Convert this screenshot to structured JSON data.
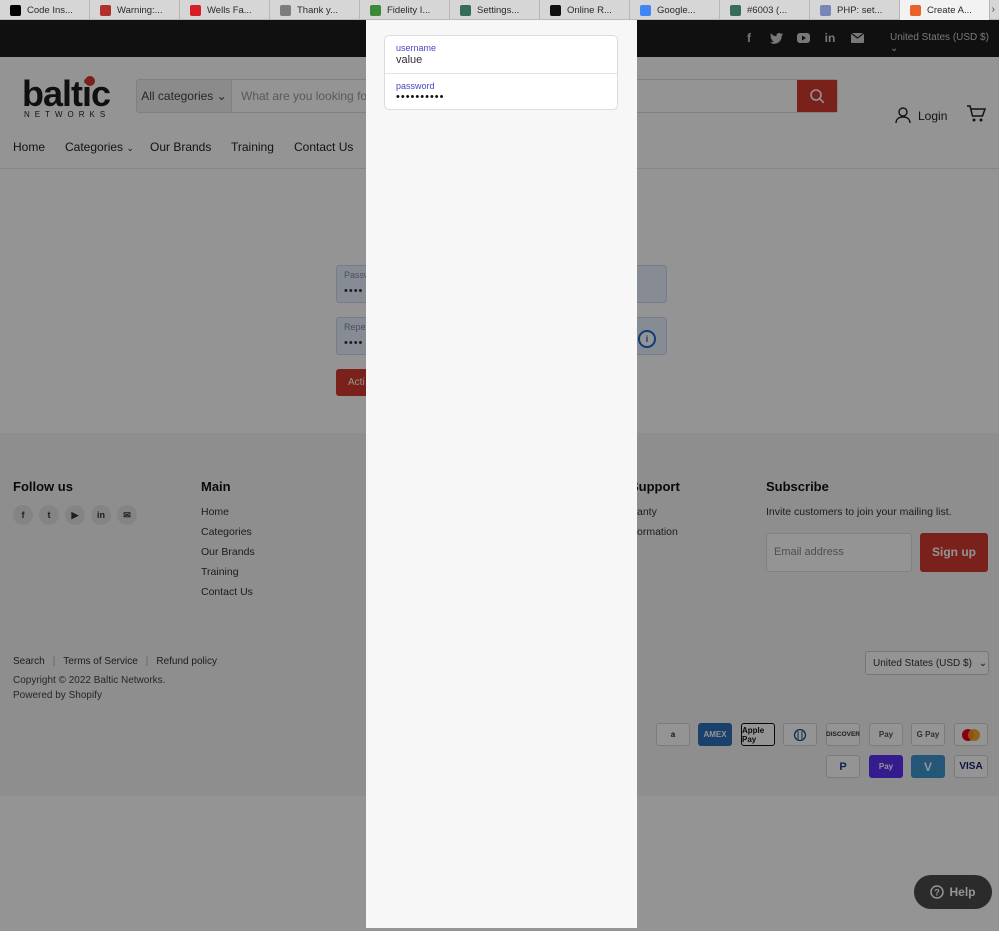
{
  "browser_tabs": [
    {
      "label": "Code Ins...",
      "icon": "jetbrains-icon",
      "color": "#000000"
    },
    {
      "label": "Warning:...",
      "icon": "alert-icon",
      "color": "#b0312c"
    },
    {
      "label": "Wells Fa...",
      "icon": "wells-fargo-icon",
      "color": "#d71e28"
    },
    {
      "label": "Thank y...",
      "icon": "u-icon",
      "color": "#7d7d7d"
    },
    {
      "label": "Fidelity I...",
      "icon": "fidelity-icon",
      "color": "#3a8a3a"
    },
    {
      "label": "Settings...",
      "icon": "rh-icon",
      "color": "#356c5a"
    },
    {
      "label": "Online R...",
      "icon": "amazon-icon",
      "color": "#111111"
    },
    {
      "label": "Google...",
      "icon": "google-ads-icon",
      "color": "#4285f4"
    },
    {
      "label": "#6003 (...",
      "icon": "rh-icon",
      "color": "#356c5a"
    },
    {
      "label": "PHP: set...",
      "icon": "php-icon",
      "color": "#7a86b8"
    },
    {
      "label": "Create A...",
      "icon": "wifi-icon",
      "color": "#e8622a"
    }
  ],
  "topbar": {
    "currency": "United States (USD $)"
  },
  "header": {
    "logo_word": "baltic",
    "logo_sub": "NETWORKS",
    "search_category": "All categories",
    "search_placeholder": "What are you looking fo",
    "login_label": "Login"
  },
  "nav": {
    "items": [
      "Home",
      "Categories",
      "Our Brands",
      "Training",
      "Contact Us"
    ]
  },
  "form": {
    "password_label": "Passw",
    "password_dots": "••••",
    "repeat_label": "Repe",
    "repeat_dots": "••••",
    "activate_label": "Acti"
  },
  "footer": {
    "follow_title": "Follow us",
    "main_title": "Main",
    "main_links": [
      "Home",
      "Categories",
      "Our Brands",
      "Training",
      "Contact Us"
    ],
    "support_title": "Support",
    "support_links": [
      "anty",
      "ormation"
    ],
    "subscribe_title": "Subscribe",
    "subscribe_text": "Invite customers to join your mailing list.",
    "email_placeholder": "Email address",
    "signup_label": "Sign up",
    "bottom_links": [
      "Search",
      "Terms of Service",
      "Refund policy"
    ],
    "copyright": "Copyright © 2022 Baltic Networks.",
    "powered": "Powered by Shopify",
    "currency": "United States (USD $)",
    "payments_row1": [
      "a",
      "AMEX",
      "Apple Pay",
      "Diners",
      "DISCOVER",
      "Pay",
      "G Pay",
      "Mastercard"
    ],
    "payments_row2": [
      "P",
      "Pay",
      "V",
      "VISA"
    ]
  },
  "help_label": "Help",
  "popup": {
    "username_label": "username",
    "username_value": "value",
    "password_label": "password",
    "password_value": "••••••••••"
  }
}
